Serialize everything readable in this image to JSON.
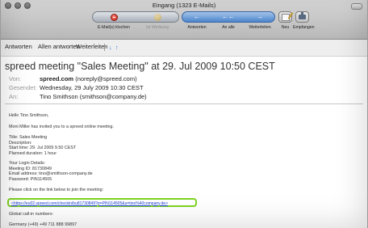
{
  "window": {
    "title": "Eingang (1323 E-Mails)"
  },
  "toolbar": {
    "delete_label": "E-Mail(s) löschen",
    "junk_label": "Ist Werbung",
    "reply_label": "Antworten",
    "reply_all_label": "An alle",
    "forward_label": "Weiterleiten",
    "new_label": "Neu",
    "get_label": "Empfangen"
  },
  "replybar": {
    "reply": "Antworten",
    "reply_all": "Allen antworten",
    "forward": "Weiterleiten"
  },
  "message": {
    "subject": "spreed meeting \"Sales Meeting\" at 29. Jul 2009 10:50 CEST",
    "from_label": "Von:",
    "from_name": "spreed.com",
    "from_addr": "(noreply@spreed.com)",
    "sent_label": "Gesendet:",
    "sent_value": "Wednesday, 29 July 2009 10:30 CEST",
    "to_label": "An:",
    "to_value": "Tino Smithson (smithson@company.de)",
    "body": {
      "greeting": "Hello Tino Smithson,",
      "invite": "Moni Miller has invited you to a spreed online meeting.",
      "title": "Title: Sales Meeting",
      "description": "Description:",
      "start_time": "Start time: 29. Jul 2009 9.50 CEST",
      "duration": "Planned duration: 1 hour",
      "login_heading": "Your Login Details:",
      "meeting_id": "Meeting ID: 81730849",
      "email": "Email address: tino@smithson-company.de",
      "password": "Password: PIN114505",
      "click_text": "Please click on the link below to join the meeting:",
      "join_link": "<https://eu02.spreed.com/checkin/bu81730849?p=PIN114505&u=tino%40company.de>",
      "call_in": "Global call-in numbers:",
      "germany": "Germany (+49) +49 711 888 99897"
    }
  }
}
